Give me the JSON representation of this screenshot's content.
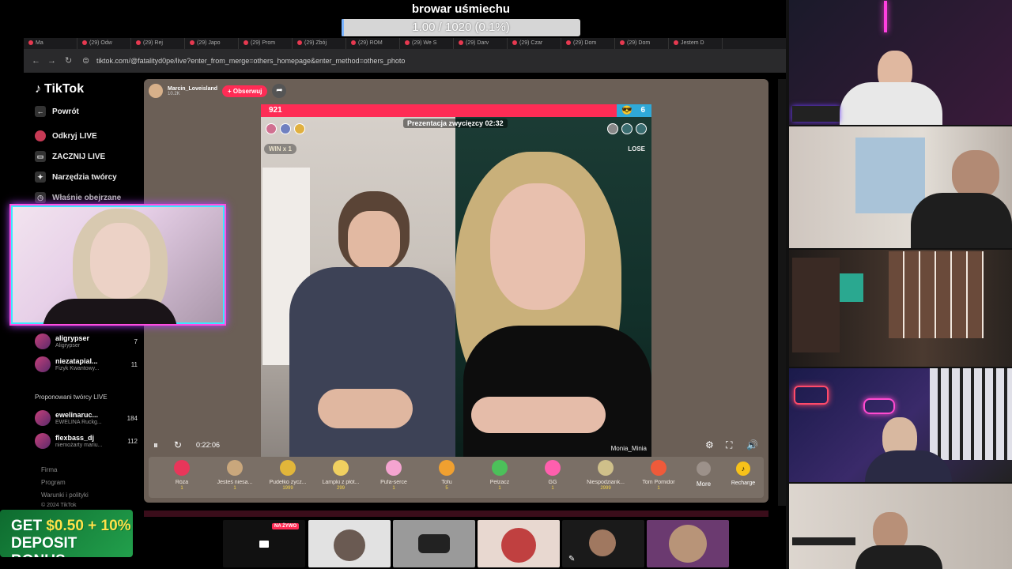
{
  "top_overlay": {
    "title": "browar uśmiechu",
    "progress_text": "1.00 / 1020 (0.1%)",
    "progress_fraction": 0.001
  },
  "browser": {
    "tabs": [
      "Ma",
      "(29) Odw",
      "(29) Rej",
      "(29) Japo",
      "(29) Prom",
      "(29) Zbój",
      "(29) ROM",
      "(29) We S",
      "(29) Darv",
      "(29) Czar",
      "(29) Dom",
      "(29) Dom",
      "Jestem D"
    ],
    "url": "tiktok.com/@fatalityd0pe/live?enter_from_merge=others_homepage&enter_method=others_photo"
  },
  "sidebar": {
    "logo": "TikTok",
    "items": [
      {
        "label": "Powrót",
        "icon": "arrow-left-icon"
      },
      {
        "label": "Odkryj LIVE",
        "icon": "live-icon"
      },
      {
        "label": "ZACZNIJ LIVE",
        "icon": "camera-icon"
      },
      {
        "label": "Narzędzia twórcy",
        "icon": "lightbulb-icon"
      },
      {
        "label": "Właśnie obejrzane",
        "icon": "history-icon"
      }
    ],
    "watched": [
      {
        "name": "aligrypser",
        "sub": "Aligrypser",
        "count": "7"
      },
      {
        "name": "niezatapial...",
        "sub": "Fizyk Kwantowy...",
        "count": "11"
      }
    ],
    "suggested_header": "Proponowani twórcy LIVE",
    "suggested": [
      {
        "name": "ewelinaruc...",
        "sub": "EWELINA Ruckg...",
        "count": "184"
      },
      {
        "name": "flexbass_dj",
        "sub": "niemożarty mariu...",
        "count": "112"
      }
    ],
    "footer": [
      "Firma",
      "Program",
      "Warunki i polityki",
      "© 2024 TikTok"
    ]
  },
  "bonus_banner": {
    "line1_prefix": "GET ",
    "amount": "$0.50 + 10%",
    "line2": "DEPOSIT BONUS"
  },
  "stream": {
    "host_name": "Marcin_Loveisland",
    "host_sub": "10.2K",
    "follow_label": "+ Obserwuj",
    "pk_left_score": "921",
    "pk_right_score": "6",
    "pk_left_fraction": 0.91,
    "pk_timer": "Prezentacja zwycięzcy 02:32",
    "win_label": "WIN x 1",
    "lose_label": "LOSE",
    "right_name": "Monia_Minia",
    "time": "0:22:06",
    "gifts": [
      {
        "name": "Róża",
        "price": "1",
        "color": "#e8365a",
        "icon": "rose-icon"
      },
      {
        "name": "Jesteś niesa...",
        "price": "1",
        "color": "#c9a77c",
        "icon": "cat-icon"
      },
      {
        "name": "Pudełko życz...",
        "price": "1999",
        "color": "#e2b63a",
        "icon": "box-icon"
      },
      {
        "name": "Lampki z płót...",
        "price": "299",
        "color": "#f0d060",
        "icon": "moon-icon"
      },
      {
        "name": "Pufa-serce",
        "price": "1",
        "color": "#f4a4d0",
        "icon": "heart-icon"
      },
      {
        "name": "Tofu",
        "price": "5",
        "color": "#f0a030",
        "icon": "tofu-icon"
      },
      {
        "name": "Pełzacz",
        "price": "1",
        "color": "#4cc05a",
        "icon": "creeper-icon"
      },
      {
        "name": "GG",
        "price": "1",
        "color": "#ff5fae",
        "icon": "gg-icon"
      },
      {
        "name": "Niespodziank...",
        "price": "2999",
        "color": "#cfc08a",
        "icon": "surprise-icon"
      },
      {
        "name": "Tom Pomidor",
        "price": "1",
        "color": "#ef5a3a",
        "icon": "tomato-icon"
      }
    ],
    "more_label": "More",
    "recharge_label": "Recharge"
  },
  "bottom_strip": {
    "live_badge": "NA ŻYWO"
  }
}
